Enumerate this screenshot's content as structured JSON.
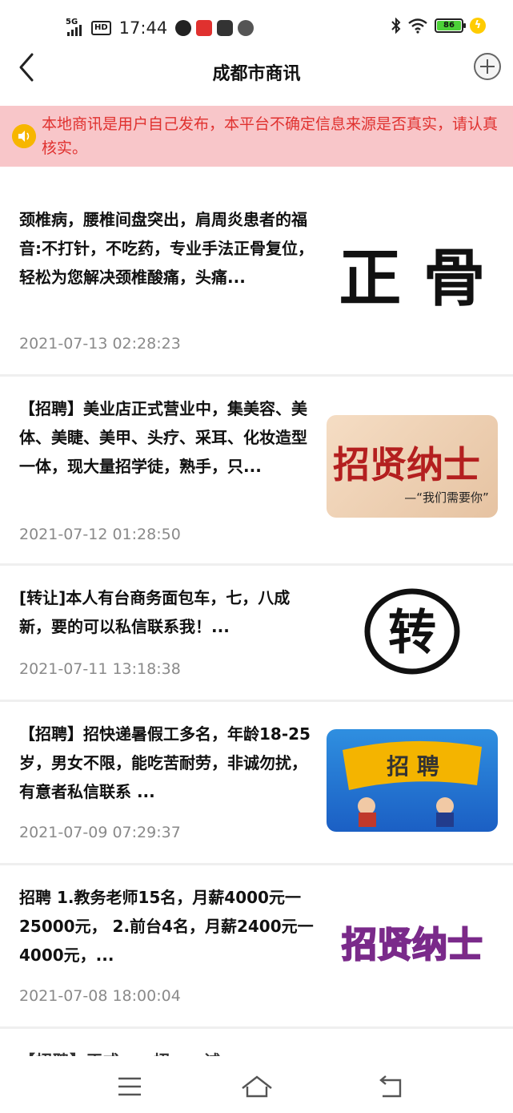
{
  "status_bar": {
    "network": "5G",
    "hd": "HD",
    "time": "17:44",
    "battery": "86",
    "colors": {
      "battery_fill": "#4cd137",
      "charge": "#ffcc00"
    }
  },
  "nav": {
    "title": "成都市商讯",
    "back_icon": "chevron-left-icon",
    "add_icon": "plus-circle-icon"
  },
  "notice": {
    "icon": "speaker-icon",
    "text": "本地商讯是用户自己发布，本平台不确定信息来源是否真实，请认真核实。",
    "colors": {
      "background": "#f8c6c9",
      "text": "#e0312f"
    }
  },
  "items": [
    {
      "title": "颈椎病，腰椎间盘突出，肩周炎患者的福音:不打针，不吃药，专业手法正骨复位，轻松为您解决颈椎酸痛，头痛...",
      "date": "2021-07-13 02:28:23",
      "thumb_text": "正 骨"
    },
    {
      "title": "【招聘】美业店正式营业中，集美容、美体、美睫、美甲、头疗、采耳、化妆造型一体，现大量招学徒，熟手，只...",
      "date": "2021-07-12 01:28:50",
      "thumb_text": "招贤纳士",
      "thumb_sub": "—“我们需要你”"
    },
    {
      "title": "[转让]本人有台商务面包车，七，八成新，要的可以私信联系我！...",
      "date": "2021-07-11 13:18:38",
      "thumb_text": "转"
    },
    {
      "title": "【招聘】招快递暑假工多名，年龄18-25岁，男女不限，能吃苦耐劳，非诚勿扰，有意者私信联系 ...",
      "date": "2021-07-09 07:29:37",
      "thumb_text": "招  聘"
    },
    {
      "title": "招聘 1.教务老师15名，月薪4000元一25000元， 2.前台4名，月薪2400元一4000元，...",
      "date": "2021-07-08 18:00:04",
      "thumb_text": "招贤纳士"
    }
  ],
  "partial_item": {
    "text": "【招聘】正式……招……诚……"
  },
  "system_nav": {
    "menu_icon": "menu-icon",
    "home_icon": "home-icon",
    "back_icon": "back-icon"
  }
}
